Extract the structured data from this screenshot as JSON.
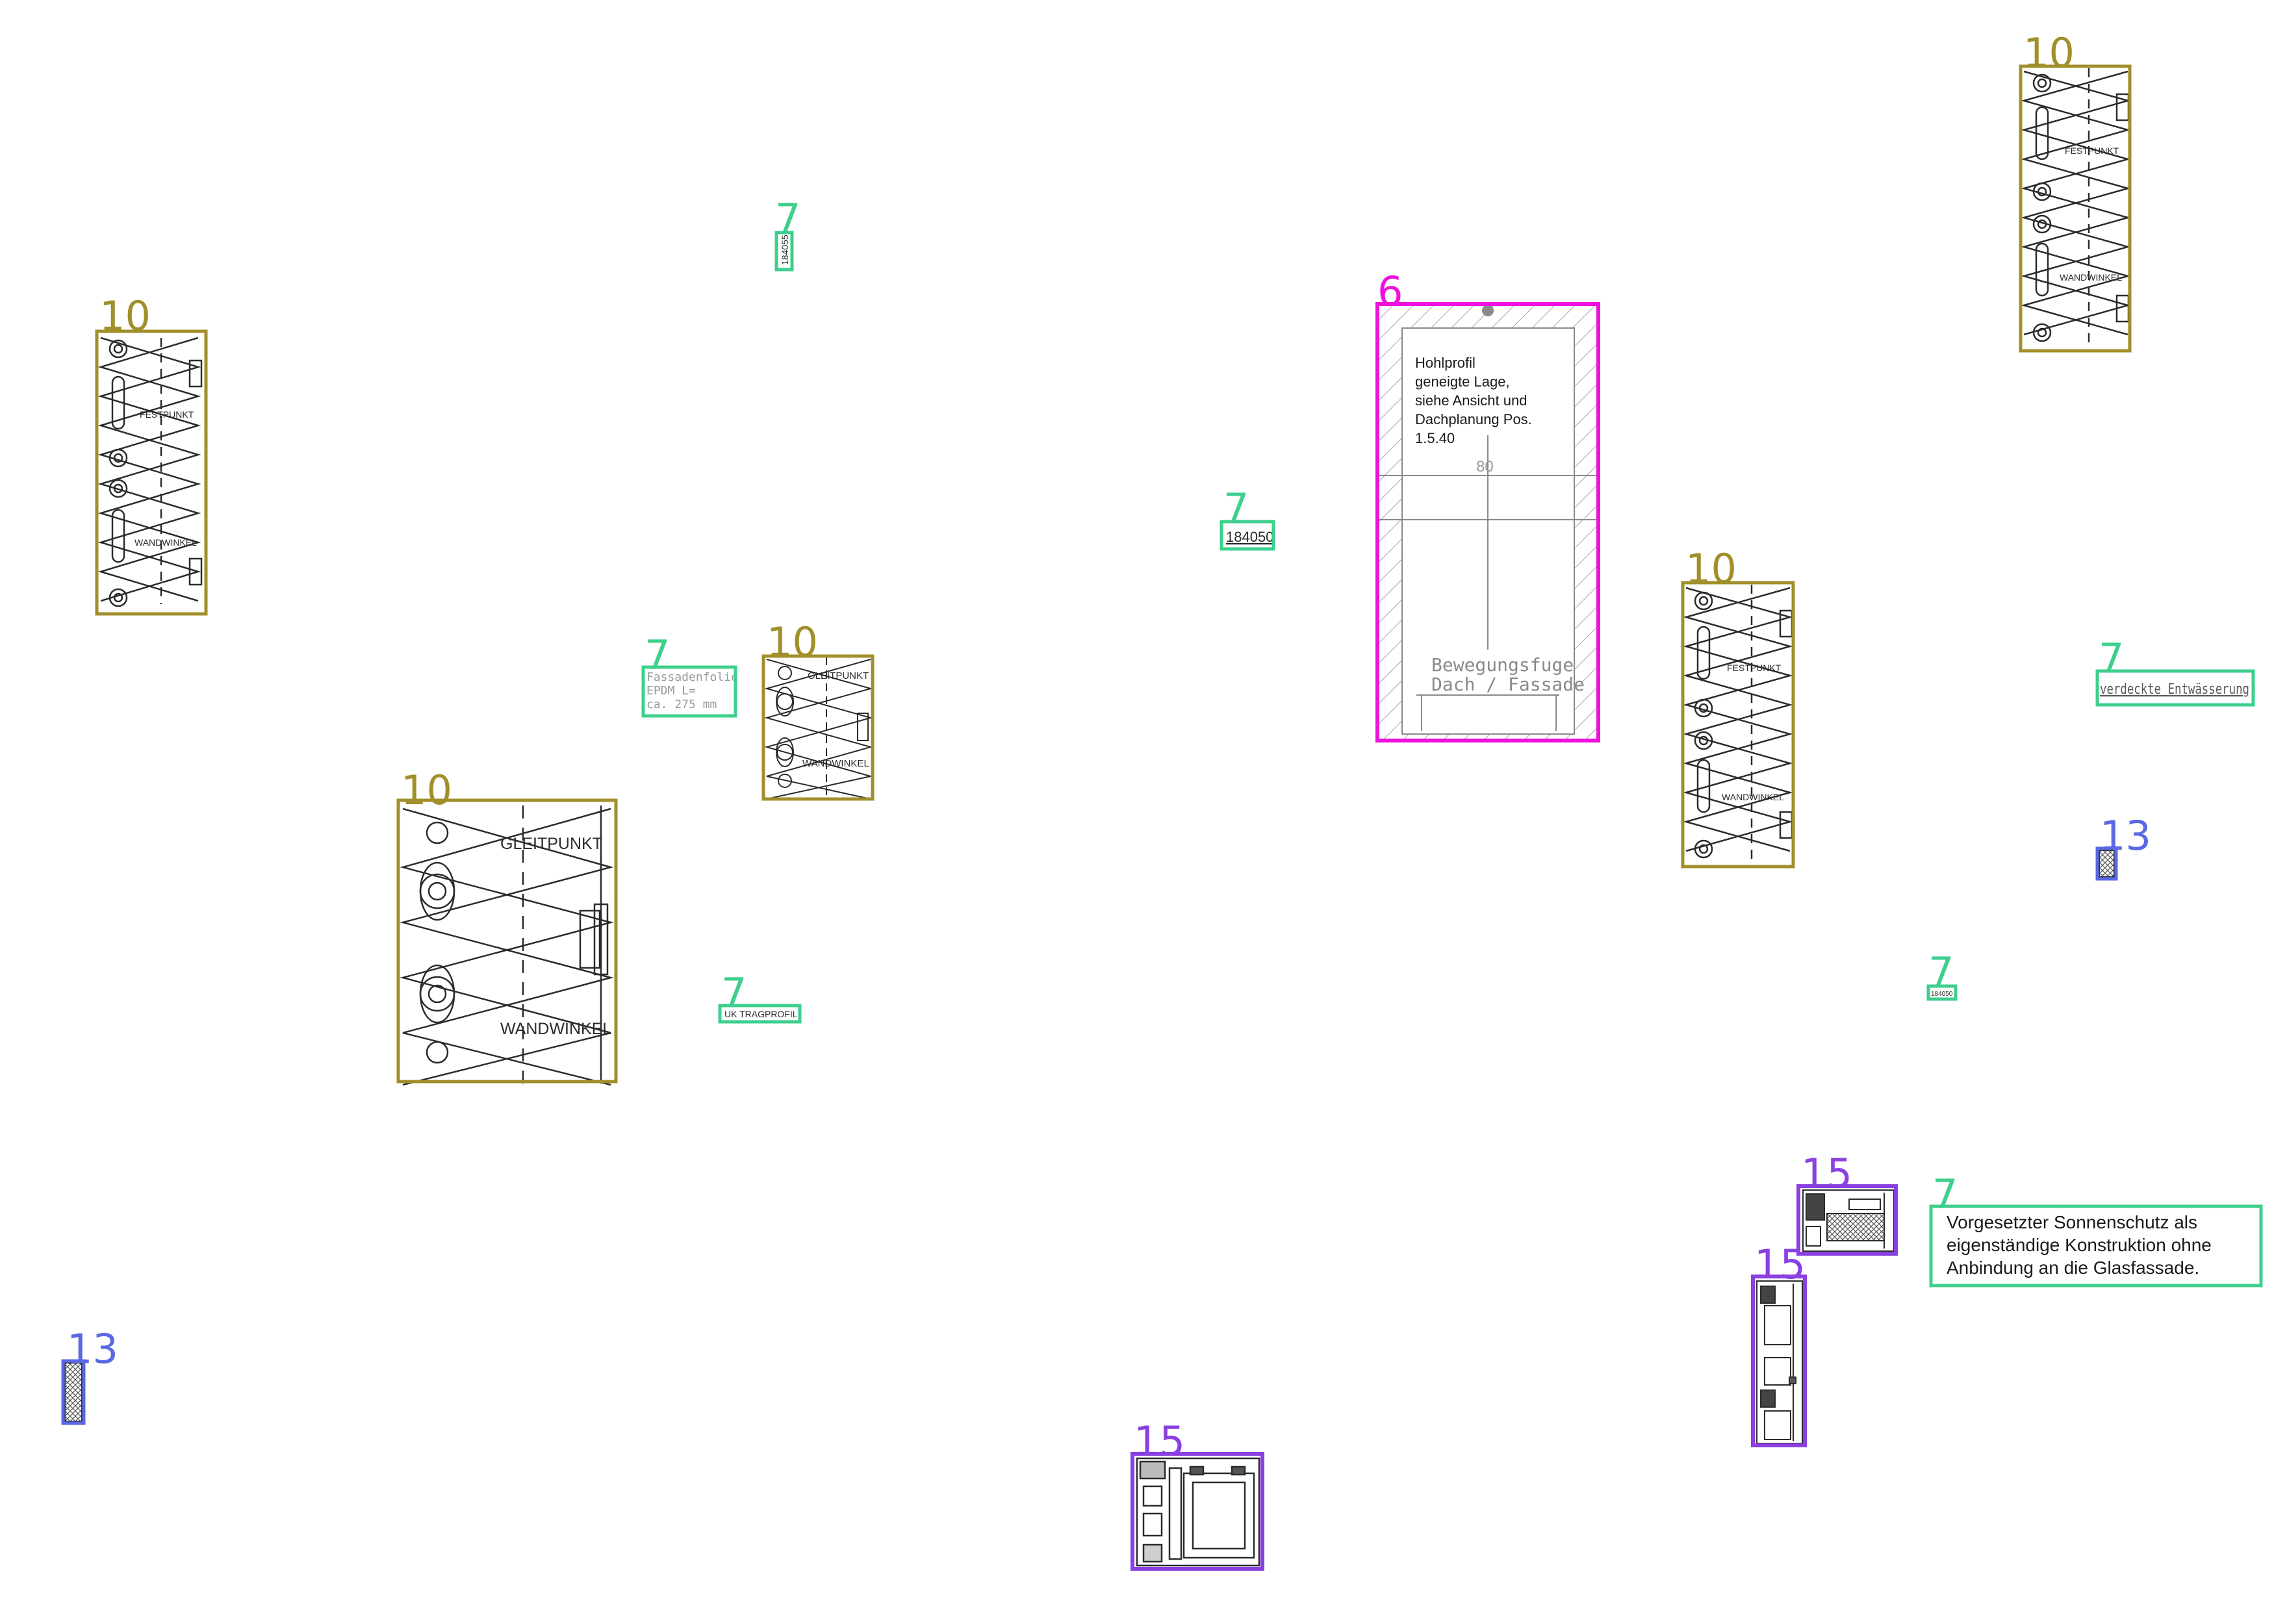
{
  "colors": {
    "background": "#ffffff",
    "class_6": "#ee11dd",
    "class_7": "#3dcf8c",
    "class_10": "#a08f2a",
    "class_13": "#5a68e6",
    "class_15": "#8a3fe0",
    "linework": "#2b2b2b",
    "hatch": "#9a9a9a"
  },
  "legend_ids": {
    "c6": "6",
    "c7": "7",
    "c10": "10",
    "c13": "13",
    "c15": "15"
  },
  "texts": {
    "festpunkt": "FESTPUNKT",
    "gleitpunkt": "GLEITPUNKT",
    "wandwinkel": "WANDWINKEL",
    "hohlprofil_lines": [
      "Hohlprofil",
      "geneigte Lage,",
      "siehe Ansicht und",
      "Dachplanung Pos.",
      "1.5.40"
    ],
    "dim_80": "80",
    "bewegungsfuge_lines": [
      "Bewegungsfuge",
      "Dach / Fassade"
    ],
    "fassadenfolie_lines": [
      "Fassadenfolie",
      "EPDM L=",
      "ca. 275 mm"
    ],
    "uk_tragprofil": "UK TRAGPROFIL",
    "profile_184050": "184050",
    "profile_rot": "184055",
    "profile_small": "184050",
    "verdeckte": "verdeckte Entwässerung",
    "sonnenschutz_lines": [
      "Vorgesetzter Sonnenschutz als",
      "eigenständige Konstruktion ohne",
      "Anbindung an die Glasfassade."
    ]
  },
  "icons": {
    "wall_bracket": "wall-bracket-detail-icon",
    "hatched_seal": "hatched-seal-icon",
    "window_profile": "window-profile-section-icon"
  }
}
